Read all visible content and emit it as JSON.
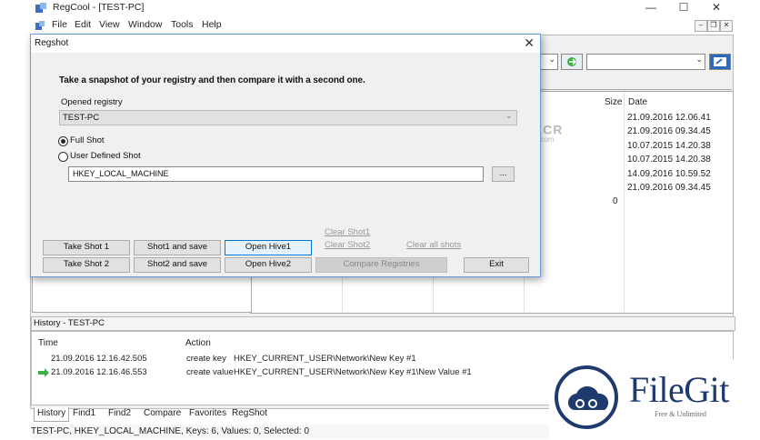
{
  "app": {
    "title": "RegCool - [TEST-PC]",
    "window_controls": {
      "minimize": "—",
      "maximize": "☐",
      "close": "✕"
    }
  },
  "menu": [
    "File",
    "Edit",
    "View",
    "Window",
    "Tools",
    "Help"
  ],
  "list": {
    "columns": {
      "size": "Size",
      "date": "Date"
    },
    "dates": [
      "21.09.2016 12.06.41",
      "21.09.2016 09.34.45",
      "10.07.2015 14.20.38",
      "10.07.2015 14.20.38",
      "14.09.2016 10.59.52",
      "21.09.2016 09.34.45"
    ],
    "size_value": "0"
  },
  "watermark": {
    "text": "FILECR",
    "suffix": ".com"
  },
  "dialog": {
    "title": "Regshot",
    "heading": "Take a snapshot of your registry and then compare it with a second one.",
    "opened_registry_label": "Opened registry",
    "opened_registry_value": "TEST-PC",
    "full_shot_label": "Full Shot",
    "user_defined_label": "User Defined Shot",
    "key_value": "HKEY_LOCAL_MACHINE",
    "browse_label": "...",
    "links": {
      "clear_shot1": "Clear Shot1",
      "clear_shot2": "Clear Shot2",
      "clear_all": "Clear all shots"
    },
    "buttons": {
      "take_shot1": "Take Shot 1",
      "shot1_save": "Shot1 and save",
      "open_hive1": "Open Hive1",
      "take_shot2": "Take Shot 2",
      "shot2_save": "Shot2 and save",
      "open_hive2": "Open Hive2",
      "compare": "Compare Registries",
      "exit": "Exit"
    }
  },
  "history": {
    "title": "History - TEST-PC",
    "columns": {
      "time": "Time",
      "action": "Action"
    },
    "rows": [
      {
        "time": "21.09.2016 12.16.42.505",
        "action": "create key",
        "path": "HKEY_CURRENT_USER\\Network\\New Key #1"
      },
      {
        "time": "21.09.2016 12.16.46.553",
        "action": "create value",
        "path": "HKEY_CURRENT_USER\\Network\\New Key #1\\New Value #1"
      }
    ]
  },
  "tabs": [
    "History",
    "Find1",
    "Find2",
    "Compare",
    "Favorites",
    "RegShot"
  ],
  "status": "TEST-PC, HKEY_LOCAL_MACHINE, Keys: 6, Values: 0, Selected: 0",
  "filegit": {
    "name": "FileGit",
    "tagline": "Free & Unlimited"
  },
  "colors": {
    "dialog_border": "#6e9bd8",
    "filegit_navy": "#1f3a6e",
    "arrow_green": "#3cb043"
  }
}
